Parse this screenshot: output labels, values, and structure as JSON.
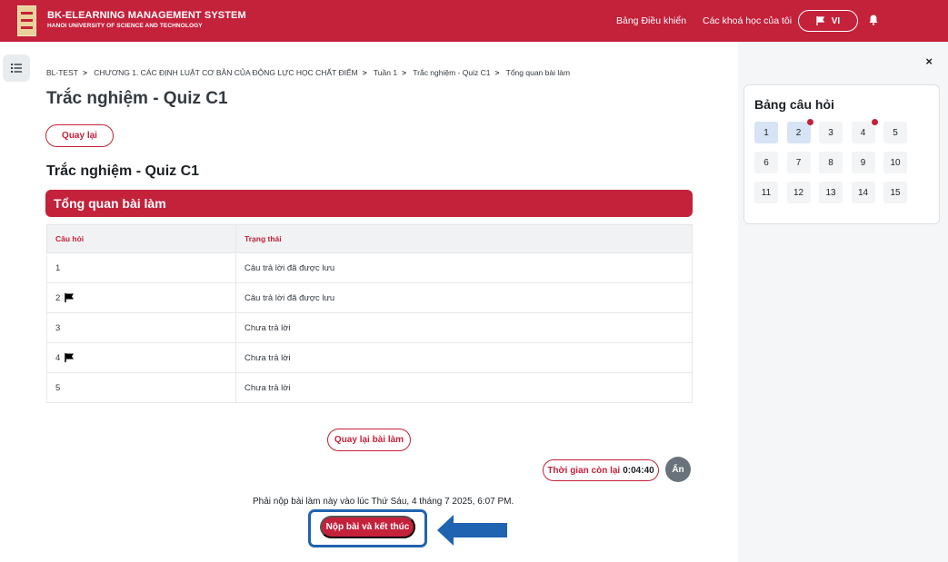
{
  "navbar": {
    "brand_title": "BK-ELEARNING MANAGEMENT SYSTEM",
    "brand_subtitle": "HANOI UNIVERSITY OF SCIENCE AND TECHNOLOGY",
    "links": [
      "Bảng Điều khiển",
      "Các khoá học của tôi"
    ],
    "language": "VI",
    "icons": [
      "flag-icon",
      "bell-icon"
    ]
  },
  "breadcrumb": [
    "BL-TEST",
    "CHƯƠNG 1. CÁC ĐỊNH LUẬT CƠ BẢN CỦA ĐỘNG LỰC HỌC CHẤT ĐIỂM",
    "Tuần 1",
    "Trắc nghiệm - Quiz C1",
    "Tổng quan bài làm"
  ],
  "page_title": "Trắc nghiệm - Quiz C1",
  "back_button": "Quay lại",
  "section_title": "Trắc nghiệm - Quiz C1",
  "summary_header": "Tổng quan bài làm",
  "table": {
    "headers": [
      "Câu hỏi",
      "Trạng thái"
    ],
    "rows": [
      {
        "question": "1",
        "status": "Câu trả lời đã được lưu",
        "flagged": false
      },
      {
        "question": "2",
        "status": "Câu trả lời đã được lưu",
        "flagged": true
      },
      {
        "question": "3",
        "status": "Chưa trả lời",
        "flagged": false
      },
      {
        "question": "4",
        "status": "Chưa trả lời",
        "flagged": true
      },
      {
        "question": "5",
        "status": "Chưa trả lời",
        "flagged": false
      }
    ]
  },
  "return_button": "Quay lại bài làm",
  "timer": {
    "label": "Thời gian còn lại",
    "value": "0:04:40"
  },
  "hide_button": "Ẩn",
  "due_text": "Phải nộp bài làm này vào lúc Thứ Sáu, 4 tháng 7 2025, 6:07 PM.",
  "submit_button": "Nộp bài và kết thúc",
  "drawer": {
    "close": "×",
    "title": "Bảng câu hỏi",
    "questions": [
      {
        "n": "1",
        "answered": true,
        "flagged": false
      },
      {
        "n": "2",
        "answered": true,
        "flagged": true
      },
      {
        "n": "3",
        "answered": false,
        "flagged": false
      },
      {
        "n": "4",
        "answered": false,
        "flagged": true
      },
      {
        "n": "5",
        "answered": false,
        "flagged": false
      },
      {
        "n": "6",
        "answered": false,
        "flagged": false
      },
      {
        "n": "7",
        "answered": false,
        "flagged": false
      },
      {
        "n": "8",
        "answered": false,
        "flagged": false
      },
      {
        "n": "9",
        "answered": false,
        "flagged": false
      },
      {
        "n": "10",
        "answered": false,
        "flagged": false
      },
      {
        "n": "11",
        "answered": false,
        "flagged": false
      },
      {
        "n": "12",
        "answered": false,
        "flagged": false
      },
      {
        "n": "13",
        "answered": false,
        "flagged": false
      },
      {
        "n": "14",
        "answered": false,
        "flagged": false
      },
      {
        "n": "15",
        "answered": false,
        "flagged": false
      }
    ]
  },
  "colors": {
    "brand": "#c4213b",
    "highlight": "#1f63b1",
    "answered": "#d6e4f5"
  }
}
